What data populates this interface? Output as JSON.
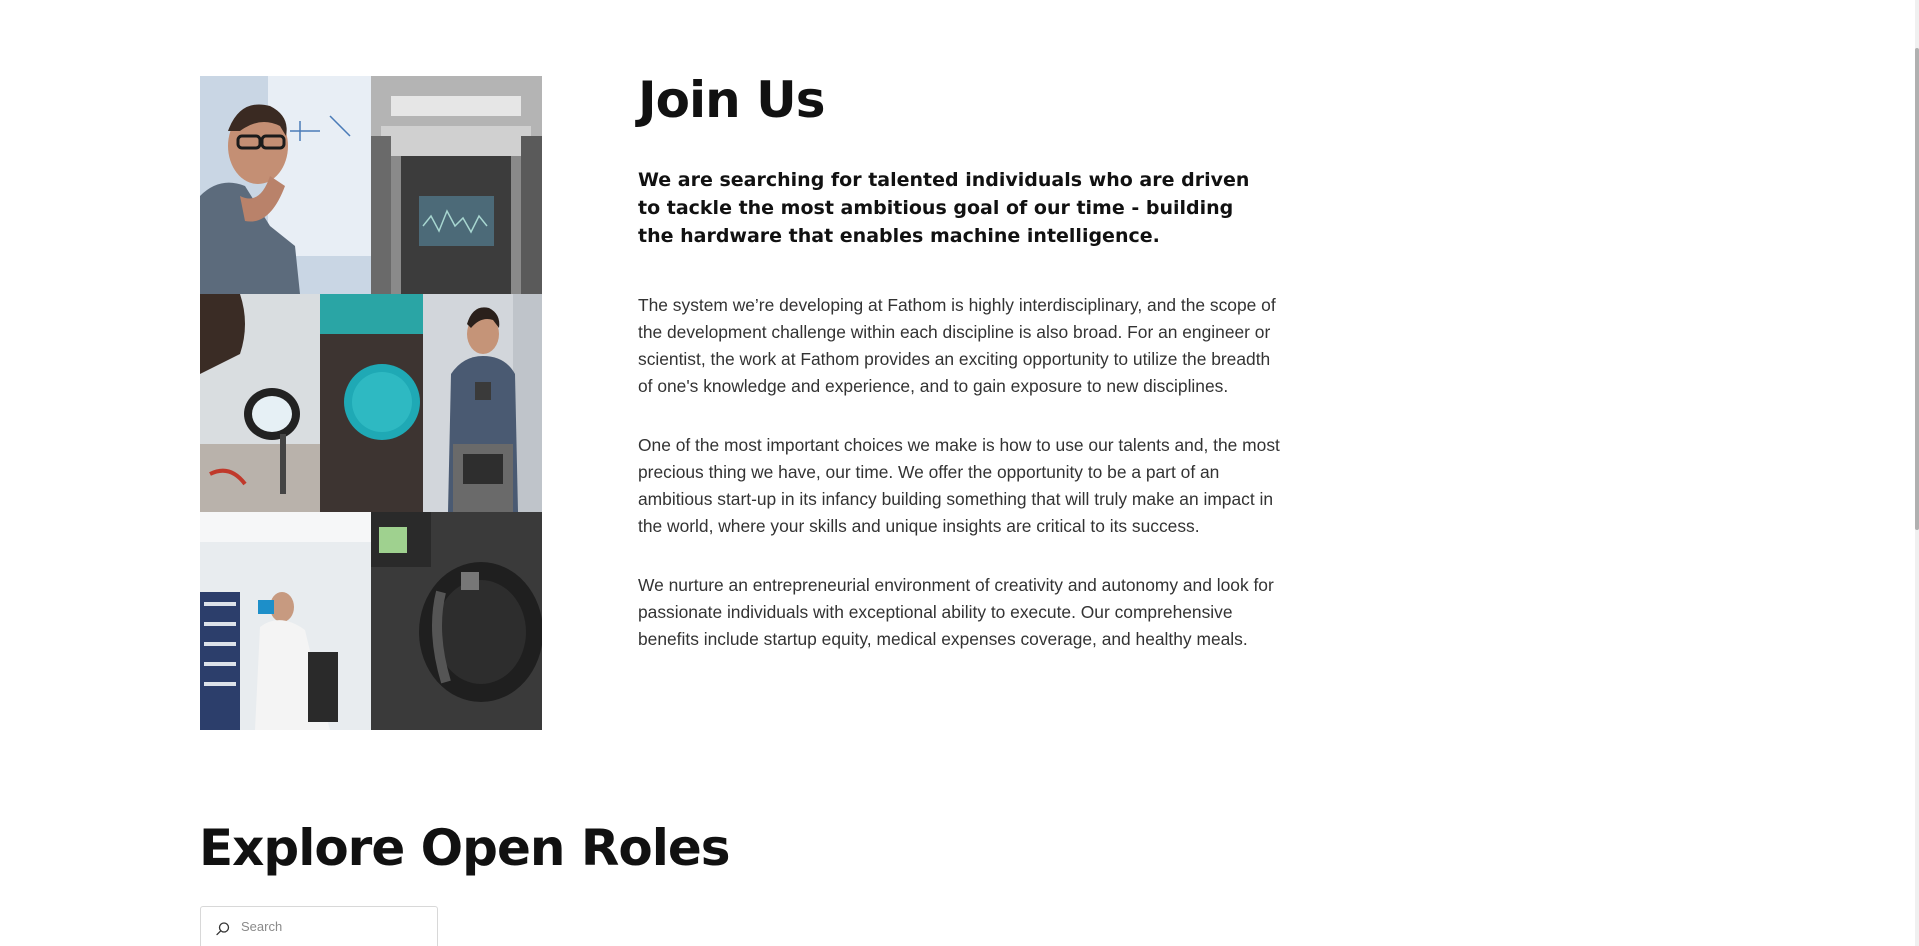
{
  "join": {
    "title": "Join Us",
    "lead": "We are searching for talented individuals who are driven to tackle the most ambitious goal of our time - building the hardware that enables machine intelligence.",
    "paragraphs": [
      "The system we’re developing at Fathom is highly interdisciplinary, and the scope of the development challenge within each discipline is also broad. For an engineer or scientist, the work at Fathom provides an exciting opportunity to utilize the breadth of one's knowledge and experience, and to gain exposure to new disciplines.",
      "One of the most important choices we make is how to use our talents and, the most precious thing we have, our time. We offer the opportunity to be a part of an ambitious start-up in its infancy building something that will truly make an impact in the world, where your skills and unique insights are critical to its success.",
      "We nurture an entrepreneurial environment of creativity and autonomy and look for passionate individuals with exceptional ability to execute. Our comprehensive benefits include startup equity, medical expenses coverage, and healthy meals."
    ]
  },
  "roles": {
    "title": "Explore Open Roles",
    "search_placeholder": "Search",
    "search_value": ""
  },
  "icons": {
    "search": "search-icon"
  }
}
